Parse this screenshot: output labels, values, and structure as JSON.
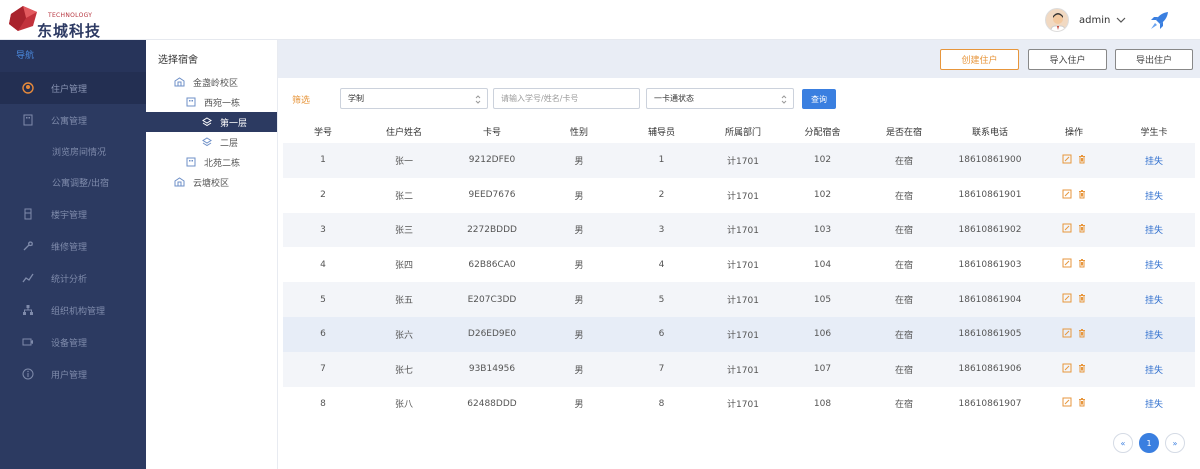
{
  "header": {
    "logo_small": "TECHNOLOGY",
    "logo_main": "东城科技",
    "username": "admin"
  },
  "sidebar": {
    "head": "导航",
    "items": [
      {
        "label": "住户管理",
        "icon": "user-icon",
        "active": true
      },
      {
        "label": "公寓管理",
        "icon": "building-icon"
      },
      {
        "label": "浏览房间情况",
        "sub": true
      },
      {
        "label": "公寓调整/出宿",
        "sub": true
      },
      {
        "label": "楼宇管理",
        "icon": "tower-icon"
      },
      {
        "label": "维修管理",
        "icon": "wrench-icon"
      },
      {
        "label": "统计分析",
        "icon": "chart-icon"
      },
      {
        "label": "组织机构管理",
        "icon": "org-icon"
      },
      {
        "label": "设备管理",
        "icon": "device-icon"
      },
      {
        "label": "用户管理",
        "icon": "info-icon"
      }
    ]
  },
  "tree": {
    "title": "选择宿舍",
    "nodes": [
      {
        "label": "金盏岭校区"
      },
      {
        "label": "西宛一栋"
      },
      {
        "label": "第一层"
      },
      {
        "label": "二层"
      },
      {
        "label": "北苑二栋"
      },
      {
        "label": "云塘校区"
      }
    ]
  },
  "toolbar": {
    "create": "创建住户",
    "import": "导入住户",
    "export": "导出住户"
  },
  "filter": {
    "label": "筛选",
    "type_value": "学制",
    "search_placeholder": "请输入学号/姓名/卡号",
    "card_status": "一卡通状态",
    "query": "查询"
  },
  "table": {
    "headers": [
      "学号",
      "住户姓名",
      "卡号",
      "性别",
      "辅导员",
      "所属部门",
      "分配宿舍",
      "是否在宿",
      "联系电话",
      "操作",
      "学生卡"
    ],
    "rows": [
      [
        "1",
        "张一",
        "9212DFE0",
        "男",
        "1",
        "计1701",
        "102",
        "在宿",
        "18610861900",
        "",
        "挂失"
      ],
      [
        "2",
        "张二",
        "9EED7676",
        "男",
        "2",
        "计1701",
        "102",
        "在宿",
        "18610861901",
        "",
        "挂失"
      ],
      [
        "3",
        "张三",
        "2272BDDD",
        "男",
        "3",
        "计1701",
        "103",
        "在宿",
        "18610861902",
        "",
        "挂失"
      ],
      [
        "4",
        "张四",
        "62B86CA0",
        "男",
        "4",
        "计1701",
        "104",
        "在宿",
        "18610861903",
        "",
        "挂失"
      ],
      [
        "5",
        "张五",
        "E207C3DD",
        "男",
        "5",
        "计1701",
        "105",
        "在宿",
        "18610861904",
        "",
        "挂失"
      ],
      [
        "6",
        "张六",
        "D26ED9E0",
        "男",
        "6",
        "计1701",
        "106",
        "在宿",
        "18610861905",
        "",
        "挂失"
      ],
      [
        "7",
        "张七",
        "93B14956",
        "男",
        "7",
        "计1701",
        "107",
        "在宿",
        "18610861906",
        "",
        "挂失"
      ],
      [
        "8",
        "张八",
        "62488DDD",
        "男",
        "8",
        "计1701",
        "108",
        "在宿",
        "18610861907",
        "",
        "挂失"
      ]
    ]
  },
  "pager": {
    "prev": "«",
    "current": "1",
    "next": "»"
  },
  "colors": {
    "accent": "#3a7fe0",
    "sidebar": "#2c3a61",
    "orange": "#e7963c"
  }
}
